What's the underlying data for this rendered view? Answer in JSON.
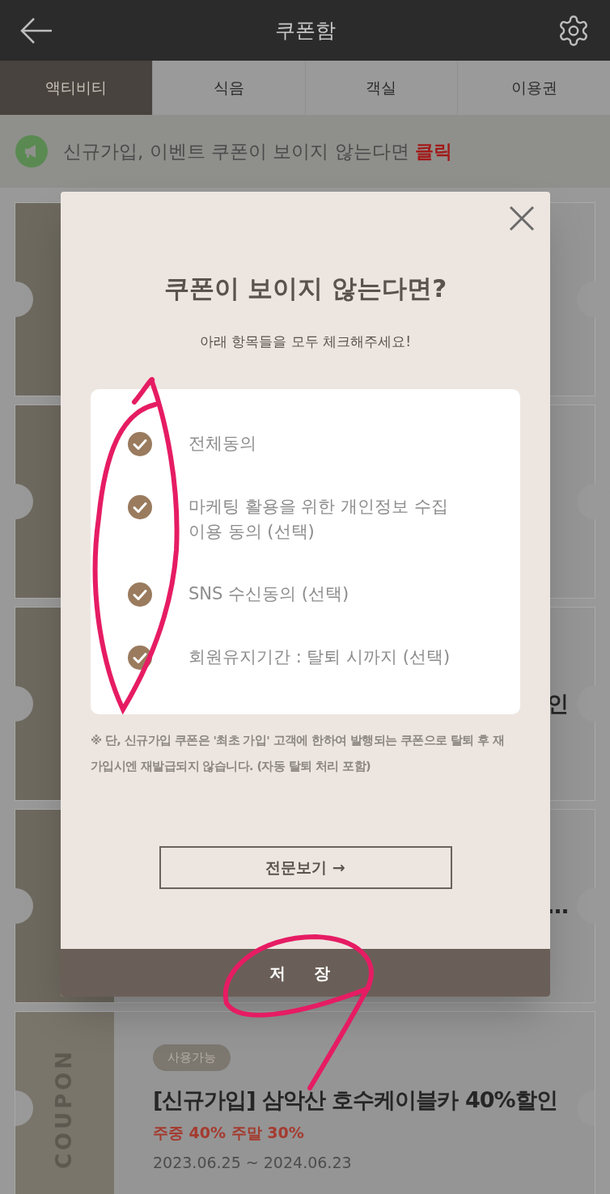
{
  "header": {
    "title": "쿠폰함"
  },
  "tabs": [
    {
      "label": "액티비티",
      "selected": true
    },
    {
      "label": "식음",
      "selected": false
    },
    {
      "label": "객실",
      "selected": false
    },
    {
      "label": "이용권",
      "selected": false
    }
  ],
  "banner": {
    "text": "신규가입, 이벤트 쿠폰이 보이지 않는다면 ",
    "link": "클릭"
  },
  "coupons": [
    {
      "kind": "hidden"
    },
    {
      "kind": "hidden"
    },
    {
      "kind": "hidden",
      "visible_text": "인"
    },
    {
      "kind": "hidden",
      "visible_text": "…"
    },
    {
      "kind": "full",
      "stub": "COUPON",
      "badge": "사용가능",
      "title": "[신규가입] 삼악산 호수케이블카 40%할인",
      "discount": "주중 40% 주말 30%",
      "period": "2023.06.25 ~ 2024.06.23"
    }
  ],
  "modal": {
    "title": "쿠폰이 보이지 않는다면?",
    "subtitle": "아래 항목들을 모두 체크해주세요!",
    "items": [
      {
        "label": "전체동의",
        "checked": true
      },
      {
        "label": "마케팅 활용을 위한 개인정보 수집\n이용 동의 (선택)",
        "checked": true
      },
      {
        "label": "SNS 수신동의 (선택)",
        "checked": true
      },
      {
        "label": "회원유지기간 : 탈퇴 시까지 (선택)",
        "checked": true
      }
    ],
    "note": "※ 단, 신규가입 쿠폰은 '최초 가입' 고객에 한하여 발행되는 쿠폰으로 탈퇴 후 재가입시엔 재발급되지 않습니다. (자동 탈퇴 처리 포함)",
    "view_button": "전문보기 →",
    "save_button": "저 장"
  }
}
